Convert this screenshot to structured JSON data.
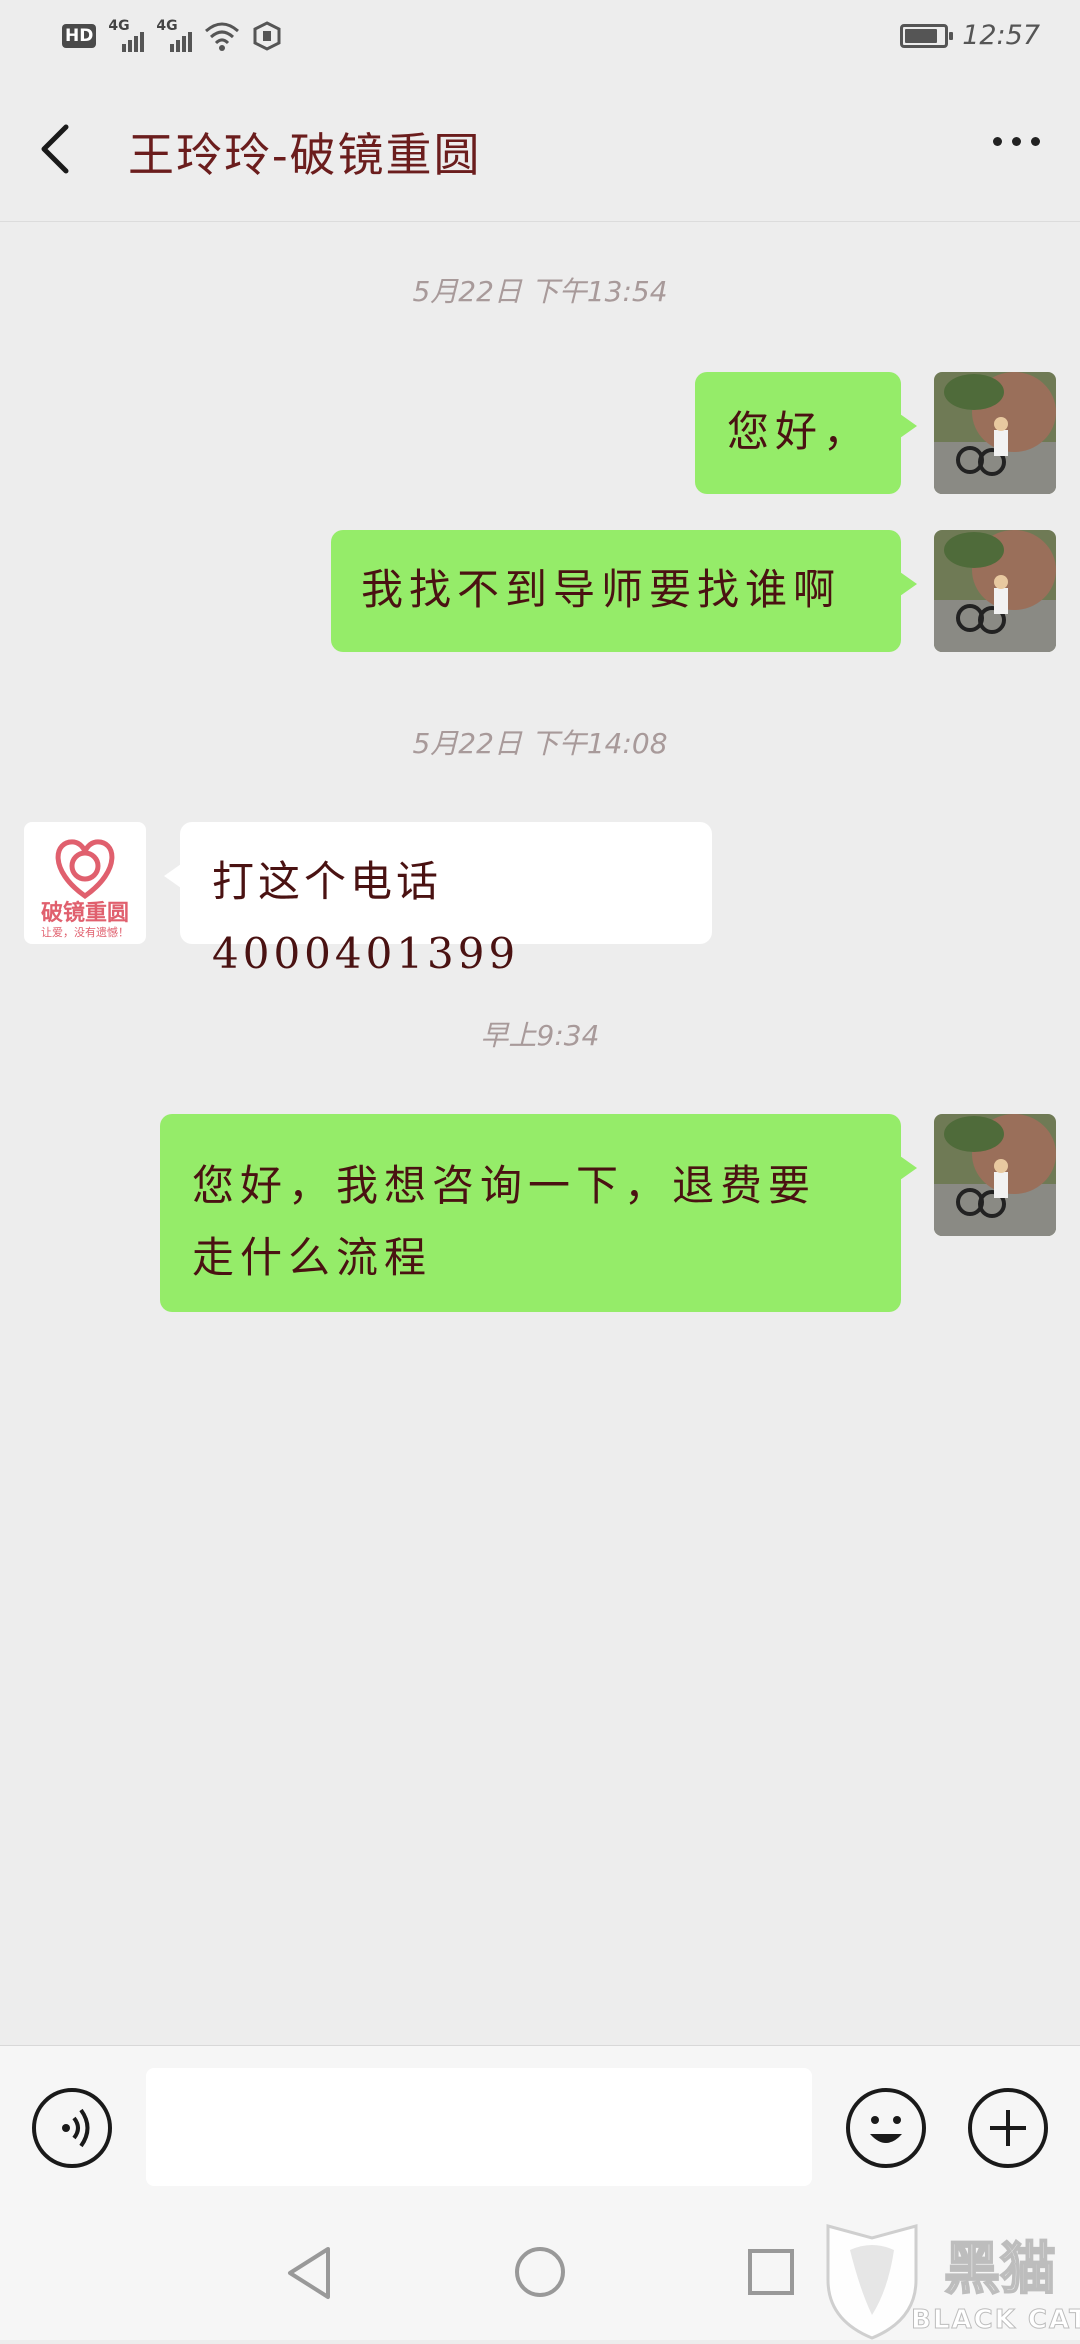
{
  "status_bar": {
    "hd": "HD",
    "net1": "4G",
    "net2": "4G",
    "battery_level": 0.85,
    "time": "12:57"
  },
  "header": {
    "title": "王玲玲-破镜重圆"
  },
  "timestamps": [
    "5月22日 下午13:54",
    "5月22日 下午14:08",
    "早上9:34"
  ],
  "messages": [
    {
      "side": "right",
      "text": "您好，"
    },
    {
      "side": "right",
      "text": "我找不到导师要找谁啊"
    },
    {
      "side": "left",
      "text": "打这个电话 4000401399"
    },
    {
      "side": "right",
      "line1": "您好，我想咨询一下，退费要",
      "line2": "走什么流程"
    }
  ],
  "contact_avatar": {
    "brand": "破镜重圆",
    "slogan": "让爱，没有遗憾！",
    "color": "#e0606e"
  },
  "colors": {
    "my_bubble": "#95ec69",
    "other_bubble": "#ffffff",
    "background": "#ededed"
  },
  "watermark": {
    "cn": "黑猫",
    "en": "BLACK CAT"
  }
}
